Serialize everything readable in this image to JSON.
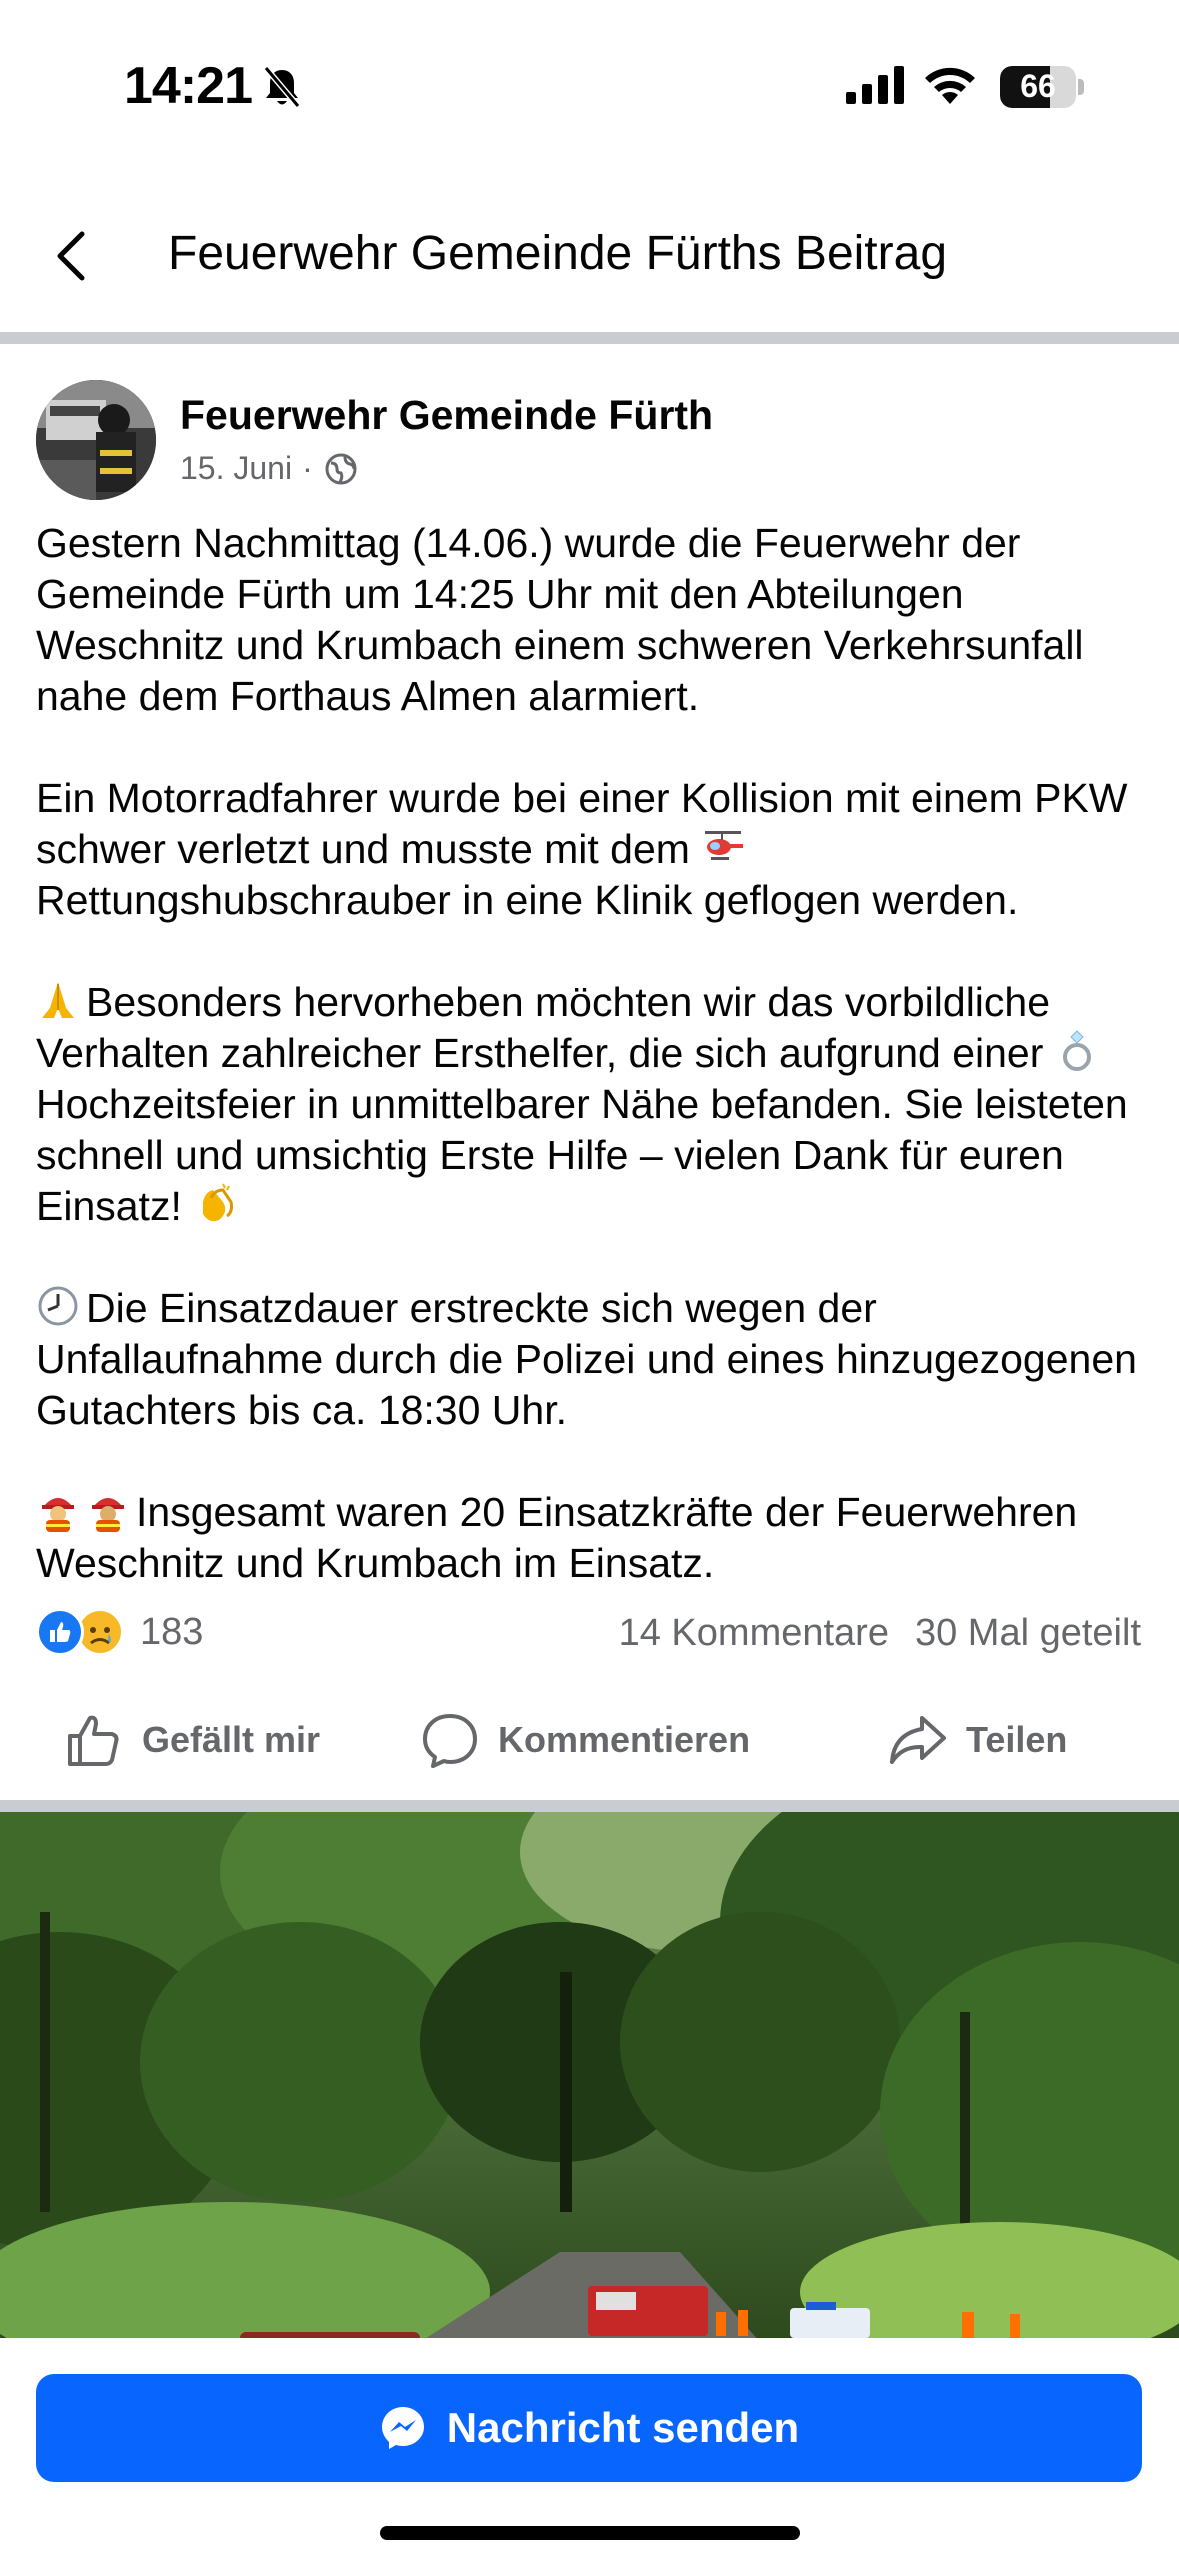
{
  "status_bar": {
    "time": "14:21",
    "battery": "66",
    "battery_level": 0.66
  },
  "nav": {
    "title": "Feuerwehr Gemeinde Fürths Beitrag"
  },
  "post": {
    "author": "Feuerwehr Gemeinde Fürth",
    "date": "15. Juni",
    "separator": "·",
    "paragraphs": {
      "p1": "Gestern Nachmittag (14.06.) wurde die Feuerwehr der Gemeinde Fürth um 14:25 Uhr mit den Abteilungen Weschnitz und Krumbach einem schweren Verkehrsunfall nahe dem Forthaus Almen alarmiert.",
      "p2a": "Ein Motorradfahrer wurde bei einer Kollision mit einem PKW schwer verletzt und musste mit dem",
      "p2b": "Rettungshubschrauber in eine Klinik geflogen werden.",
      "p3a": "Besonders hervorheben möchten wir das vorbildliche Verhalten zahlreicher Ersthelfer, die sich aufgrund einer",
      "p3b": "Hochzeitsfeier in unmittelbarer Nähe befanden. Sie leisteten schnell und umsichtig Erste Hilfe – vielen Dank für euren Einsatz!",
      "p4": "Die Einsatzdauer erstreckte sich wegen der Unfallaufnahme durch die Polizei und eines hinzugezogenen Gutachters bis ca. 18:30 Uhr.",
      "p5": "Insgesamt waren 20 Einsatzkräfte der Feuerwehren Weschnitz und Krumbach im Einsatz."
    },
    "emojis": [
      "helicopter-emoji",
      "pray-emoji",
      "ring-emoji",
      "clap-emoji",
      "clock-emoji",
      "firefighter-emoji"
    ]
  },
  "engagement": {
    "reaction_count": "183",
    "comments": "14 Kommentare",
    "shares": "30 Mal geteilt"
  },
  "actions": {
    "like": "Gefällt mir",
    "comment": "Kommentieren",
    "share": "Teilen"
  },
  "bottom": {
    "send_label": "Nachricht senden"
  },
  "colors": {
    "brand_blue": "#0866ff",
    "secondary_text": "#65676b",
    "divider": "#c9ccd1"
  }
}
